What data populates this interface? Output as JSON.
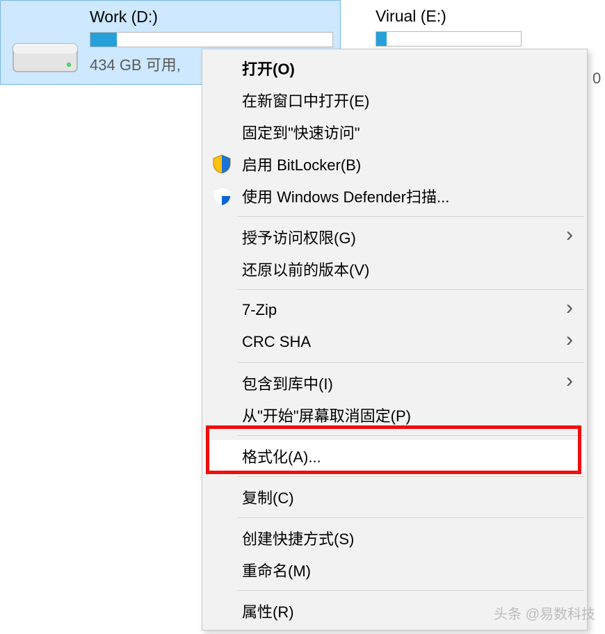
{
  "drives": {
    "selected": {
      "label": "Work (D:)",
      "free_text": "434 GB 可用,"
    },
    "other": {
      "label": "Virual (E:)"
    }
  },
  "truncated_char": "0",
  "context_menu": {
    "items": [
      {
        "label": "打开(O)",
        "bold": true
      },
      {
        "label": "在新窗口中打开(E)"
      },
      {
        "label": "固定到\"快速访问\""
      },
      {
        "label": "启用 BitLocker(B)",
        "icon": "bitlocker"
      },
      {
        "label": "使用 Windows Defender扫描...",
        "icon": "defender"
      },
      {
        "sep": true
      },
      {
        "label": "授予访问权限(G)",
        "submenu": true
      },
      {
        "label": "还原以前的版本(V)"
      },
      {
        "sep": true
      },
      {
        "label": "7-Zip",
        "submenu": true
      },
      {
        "label": "CRC SHA",
        "submenu": true
      },
      {
        "sep": true
      },
      {
        "label": "包含到库中(I)",
        "submenu": true
      },
      {
        "label": "从\"开始\"屏幕取消固定(P)"
      },
      {
        "sep": true
      },
      {
        "label": "格式化(A)...",
        "highlight": true
      },
      {
        "sep": true
      },
      {
        "label": "复制(C)"
      },
      {
        "sep": true
      },
      {
        "label": "创建快捷方式(S)"
      },
      {
        "label": "重命名(M)"
      },
      {
        "sep": true
      },
      {
        "label": "属性(R)"
      }
    ]
  },
  "watermark": "头条 @易数科技"
}
